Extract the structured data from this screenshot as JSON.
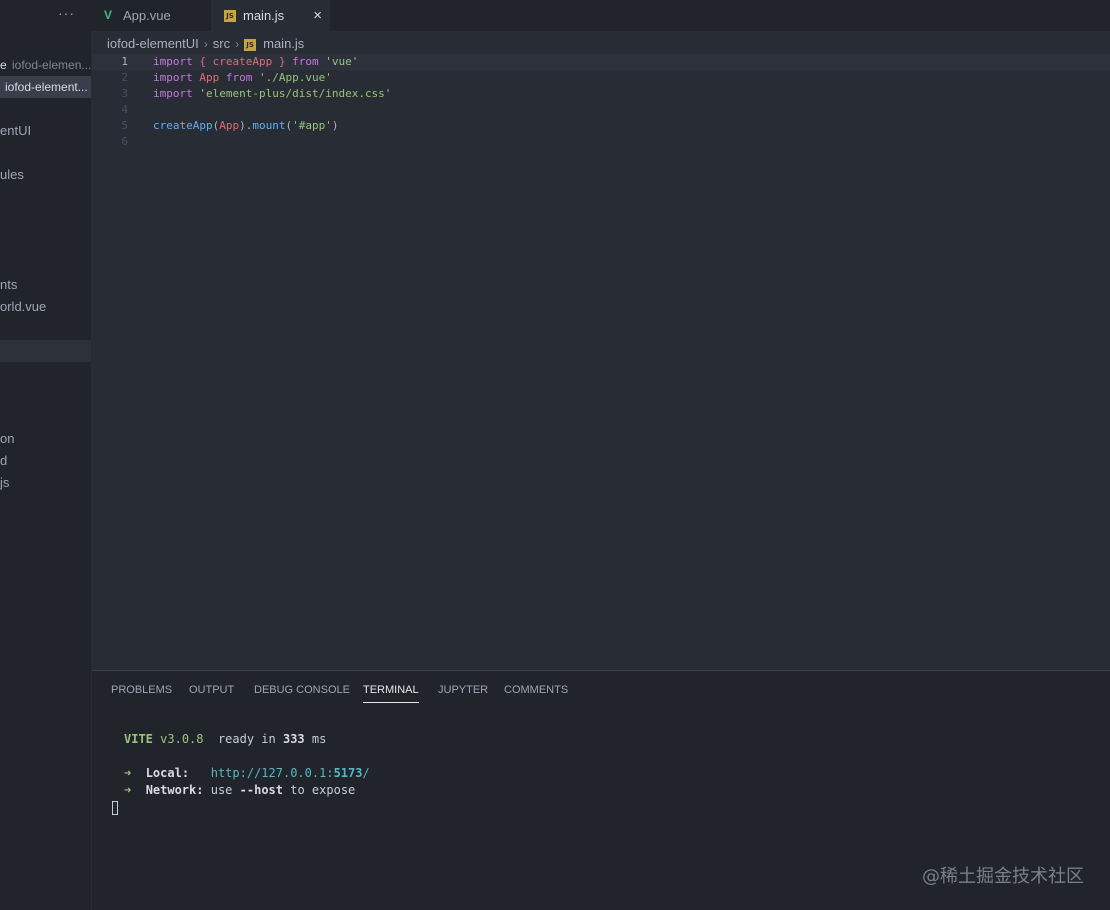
{
  "tabs": {
    "more_label": "···",
    "inactive": {
      "label": "App.vue",
      "icon": "vue-icon"
    },
    "active": {
      "label": "main.js",
      "icon": "js-icon",
      "close": "×"
    }
  },
  "sidebar": {
    "open_editors": [
      {
        "prefix": "e",
        "folder": "iofod-elemen..."
      },
      {
        "prefix": "",
        "folder": "iofod-element..."
      }
    ],
    "items": [
      {
        "label": "entUI"
      },
      {
        "label": "ules"
      },
      {
        "label": "nts"
      },
      {
        "label": "orld.vue"
      },
      {
        "label": ""
      },
      {
        "label": "on"
      },
      {
        "label": "d"
      },
      {
        "label": "js"
      }
    ]
  },
  "breadcrumb": {
    "project": "iofod-elementUI",
    "folder": "src",
    "file": "main.js",
    "sep": "›",
    "file_icon": "js-icon"
  },
  "editor": {
    "lines": [
      {
        "num": "1",
        "tokens": [
          {
            "t": "kw",
            "v": "import"
          },
          {
            "t": "punc",
            "v": " "
          },
          {
            "t": "id",
            "v": "{"
          },
          {
            "t": "punc",
            "v": " "
          },
          {
            "t": "id",
            "v": "createApp"
          },
          {
            "t": "punc",
            "v": " "
          },
          {
            "t": "id",
            "v": "}"
          },
          {
            "t": "punc",
            "v": " "
          },
          {
            "t": "kw",
            "v": "from"
          },
          {
            "t": "punc",
            "v": " "
          },
          {
            "t": "str",
            "v": "'vue'"
          }
        ]
      },
      {
        "num": "2",
        "tokens": [
          {
            "t": "kw",
            "v": "import"
          },
          {
            "t": "punc",
            "v": " "
          },
          {
            "t": "id",
            "v": "App"
          },
          {
            "t": "punc",
            "v": " "
          },
          {
            "t": "kw",
            "v": "from"
          },
          {
            "t": "punc",
            "v": " "
          },
          {
            "t": "str",
            "v": "'./App.vue'"
          }
        ]
      },
      {
        "num": "3",
        "tokens": [
          {
            "t": "kw",
            "v": "import"
          },
          {
            "t": "punc",
            "v": " "
          },
          {
            "t": "str",
            "v": "'element-plus/dist/index.css'"
          }
        ]
      },
      {
        "num": "4",
        "tokens": []
      },
      {
        "num": "5",
        "tokens": [
          {
            "t": "fn",
            "v": "createApp"
          },
          {
            "t": "punc",
            "v": "("
          },
          {
            "t": "id",
            "v": "App"
          },
          {
            "t": "punc",
            "v": ")."
          },
          {
            "t": "fn",
            "v": "mount"
          },
          {
            "t": "punc",
            "v": "("
          },
          {
            "t": "str",
            "v": "'#app'"
          },
          {
            "t": "punc",
            "v": ")"
          }
        ]
      },
      {
        "num": "6",
        "tokens": []
      }
    ],
    "current_line": 1
  },
  "panel": {
    "tabs": [
      "PROBLEMS",
      "OUTPUT",
      "DEBUG CONSOLE",
      "TERMINAL",
      "JUPYTER",
      "COMMENTS"
    ],
    "active_tab": "TERMINAL"
  },
  "terminal": {
    "vite_name": "VITE",
    "vite_version": "v3.0.8",
    "ready_text": "ready in",
    "ready_ms": "333",
    "ms_unit": "ms",
    "arrow": "➜",
    "local_label": "Local",
    "local_url_prefix": "http://127.0.0.1:",
    "local_port": "5173",
    "local_url_suffix": "/",
    "network_label": "Network",
    "network_use": "use",
    "network_flag": "--host",
    "network_rest": "to expose"
  },
  "watermark": "@稀土掘金技术社区"
}
